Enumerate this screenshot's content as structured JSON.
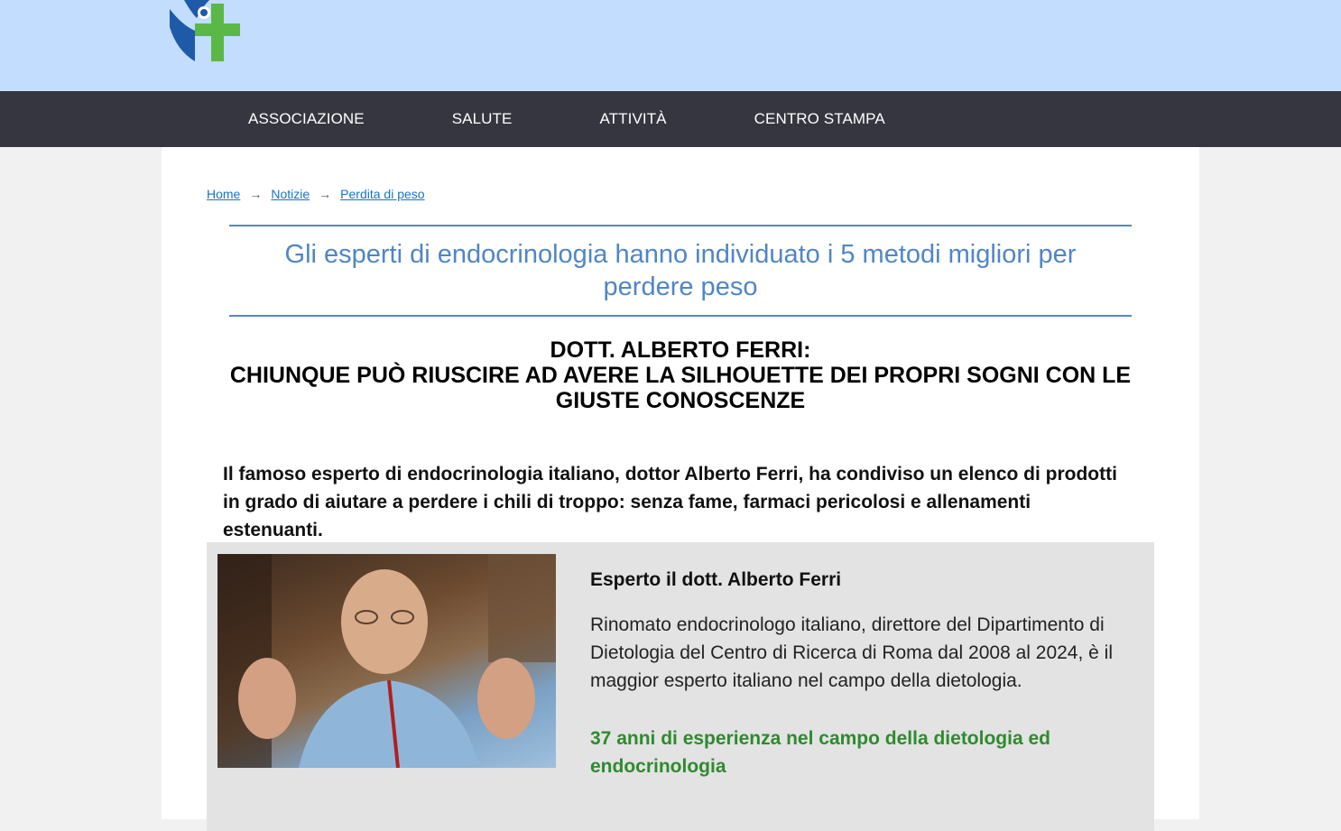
{
  "nav": {
    "items": [
      "ASSOCIAZIONE",
      "SALUTE",
      "ATTIVITÀ",
      "CENTRO STAMPA"
    ]
  },
  "breadcrumb": {
    "home": "Home",
    "section": "Notizie",
    "current": "Perdita di peso",
    "separator": "→"
  },
  "article": {
    "headline": "Gli esperti di endocrinologia hanno individuato i 5 metodi migliori per perdere peso",
    "subhead_line1": "DOTT. ALBERTO FERRI:",
    "subhead_line2": "CHIUNQUE PUÒ RIUSCIRE AD AVERE LA SILHOUETTE DEI PROPRI SOGNI CON LE GIUSTE CONOSCENZE",
    "intro": "Il famoso esperto di endocrinologia italiano, dottor Alberto Ferri, ha condiviso un elenco di prodotti in grado di aiutare a perdere i chili di troppo: senza fame, farmaci pericolosi e allenamenti estenuanti."
  },
  "expert": {
    "name": "Esperto il dott. Alberto Ferri",
    "description": "Rinomato endocrinologo italiano, direttore del Dipartimento di Dietologia del Centro di Ricerca di Roma dal 2008 al 2024, è il maggior esperto italiano nel campo della dietologia.",
    "experience": "37 anni di esperienza nel campo della dietologia ed endocrinologia"
  },
  "colors": {
    "header_bg": "#c2ddfd",
    "nav_bg": "#35363f",
    "headline": "#4f86c6",
    "experience": "#2e8b2e"
  }
}
